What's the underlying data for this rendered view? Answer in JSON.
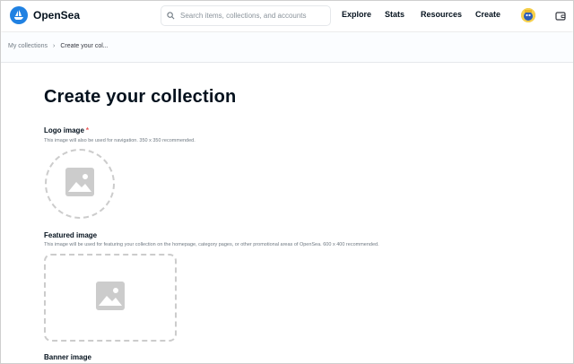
{
  "brand": {
    "name": "OpenSea",
    "accent": "#2081e2"
  },
  "search": {
    "placeholder": "Search items, collections, and accounts",
    "icon": "search-icon"
  },
  "nav": {
    "explore": "Explore",
    "stats": "Stats",
    "resources": "Resources",
    "create": "Create"
  },
  "breadcrumb": {
    "parent": "My collections",
    "separator": "›",
    "current": "Create your col..."
  },
  "page": {
    "title": "Create your collection"
  },
  "form": {
    "logo": {
      "label": "Logo image",
      "required_marker": "*",
      "help": "This image will also be used for navigation. 350 x 350 recommended.",
      "icon": "image-placeholder-icon"
    },
    "featured": {
      "label": "Featured image",
      "help": "This image will be used for featuring your collection on the homepage, category pages, or other promotional areas of OpenSea. 600 x 400 recommended.",
      "icon": "image-placeholder-icon"
    },
    "banner": {
      "label": "Banner image"
    }
  }
}
